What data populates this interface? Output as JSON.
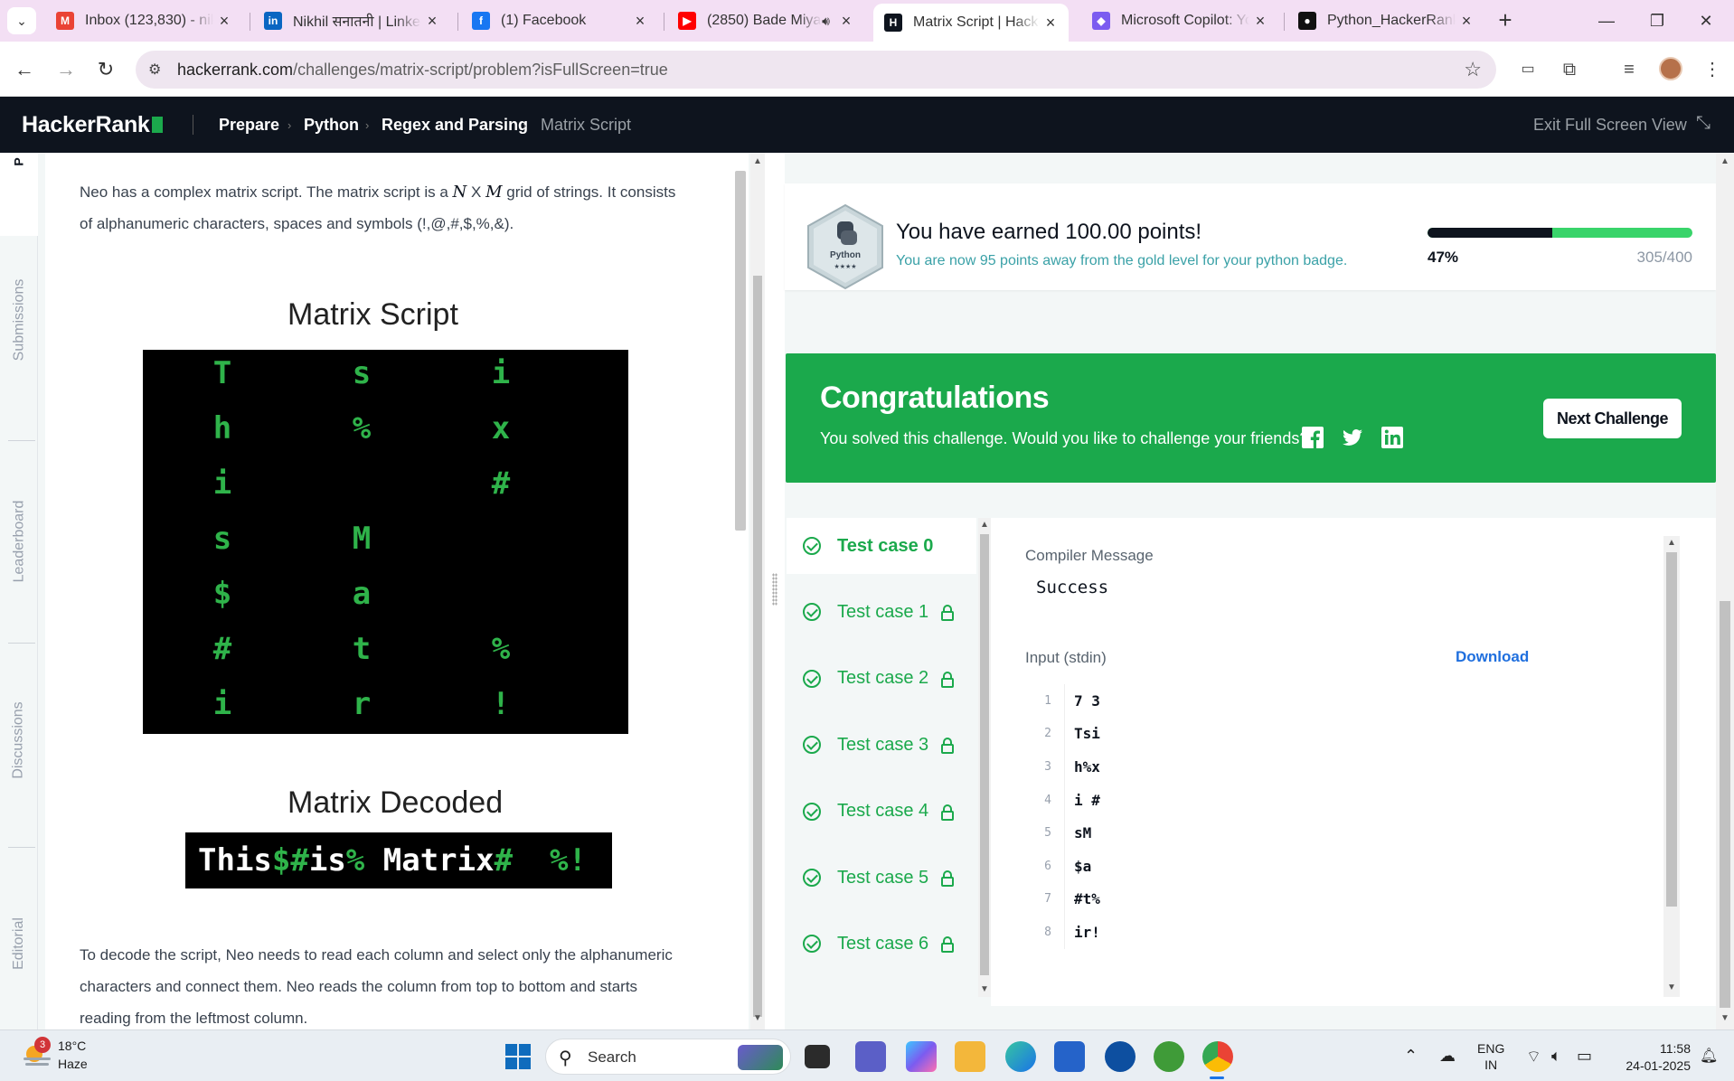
{
  "browser": {
    "tabs": [
      {
        "title": "Inbox (123,830) - nikl",
        "icon": "gmail-icon",
        "color": "#ea4335"
      },
      {
        "title": "Nikhil सनातनी | Linked",
        "icon": "linkedin-icon",
        "color": "#0a66c2"
      },
      {
        "title": "(1) Facebook",
        "icon": "facebook-icon",
        "color": "#1877f2"
      },
      {
        "title": "(2850) Bade Miya",
        "icon": "youtube-icon",
        "color": "#ff0000"
      },
      {
        "title": "Matrix Script | Hacke",
        "icon": "hackerrank-icon",
        "color": "#0e141e"
      },
      {
        "title": "Microsoft Copilot: Yo",
        "icon": "copilot-icon",
        "color": "#7b5cf0"
      },
      {
        "title": "Python_HackerRank/",
        "icon": "github-icon",
        "color": "#111111"
      }
    ],
    "url_host": "hackerrank.com",
    "url_path": "/challenges/matrix-script/problem?isFullScreen=true"
  },
  "header": {
    "logo": "HackerRank",
    "breadcrumbs": [
      "Prepare",
      "Python",
      "Regex and Parsing",
      "Matrix Script"
    ],
    "exit_label": "Exit Full Screen View"
  },
  "leftnav": {
    "items": [
      "Submissions",
      "Leaderboard",
      "Discussions",
      "Editorial"
    ],
    "top_letter": "P"
  },
  "problem": {
    "intro_a": "Neo has a complex matrix script. The matrix script is a ",
    "intro_n": "N",
    "intro_x": " X ",
    "intro_m": "M",
    "intro_b": " grid of strings. It consists",
    "intro_line2": "of alphanumeric characters, spaces and symbols (!,@,#,$,%,&).",
    "figure_title": "Matrix Script",
    "matrix_rows": [
      "T s i",
      "h % x",
      "i   #",
      "s M  ",
      "$ a  ",
      "# t %",
      "i r !"
    ],
    "decoded_title": "Matrix Decoded",
    "decoded_parts": [
      {
        "t": "This",
        "g": false
      },
      {
        "t": "$#",
        "g": true
      },
      {
        "t": "is",
        "g": false
      },
      {
        "t": "%",
        "g": true
      },
      {
        "t": " Matrix",
        "g": false
      },
      {
        "t": "#  %!",
        "g": true
      }
    ],
    "decode_line1": "To decode the script, Neo needs to read each column and select only the alphanumeric",
    "decode_line2": "characters and connect them. Neo reads the column from top to bottom and starts",
    "decode_line3": "reading from the leftmost column."
  },
  "badge": {
    "hex_label": "Python",
    "stars": "★★★★",
    "earned": "You have earned 100.00 points!",
    "away": "You are now 95 points away from the gold level for your python badge.",
    "progress": 0.47,
    "percent_label": "47%",
    "points_label": "305/400"
  },
  "congrats": {
    "title": "Congratulations",
    "subtitle": "You solved this challenge. Would you like to challenge your friends?",
    "next_button": "Next Challenge"
  },
  "testcases": [
    {
      "label": "Test case 0",
      "locked": false,
      "active": true
    },
    {
      "label": "Test case 1",
      "locked": true,
      "active": false
    },
    {
      "label": "Test case 2",
      "locked": true,
      "active": false
    },
    {
      "label": "Test case 3",
      "locked": true,
      "active": false
    },
    {
      "label": "Test case 4",
      "locked": true,
      "active": false
    },
    {
      "label": "Test case 5",
      "locked": true,
      "active": false
    },
    {
      "label": "Test case 6",
      "locked": true,
      "active": false
    }
  ],
  "output": {
    "compiler_label": "Compiler Message",
    "compiler_value": "Success",
    "input_label": "Input (stdin)",
    "download_label": "Download",
    "lines": [
      {
        "n": "1",
        "t": "7 3"
      },
      {
        "n": "2",
        "t": "Tsi"
      },
      {
        "n": "3",
        "t": "h%x"
      },
      {
        "n": "4",
        "t": "i #"
      },
      {
        "n": "5",
        "t": "sM"
      },
      {
        "n": "6",
        "t": "$a"
      },
      {
        "n": "7",
        "t": "#t%"
      },
      {
        "n": "8",
        "t": "ir!"
      }
    ]
  },
  "taskbar": {
    "weather_temp": "18°C",
    "weather_cond": "Haze",
    "weather_badge": "3",
    "search_label": "Search",
    "lang_line1": "ENG",
    "lang_line2": "IN",
    "time": "11:58",
    "date": "24-01-2025"
  },
  "colors": {
    "accent_green": "#1ba94c",
    "hr_dark": "#0e141e",
    "link_blue": "#1f6fde"
  }
}
